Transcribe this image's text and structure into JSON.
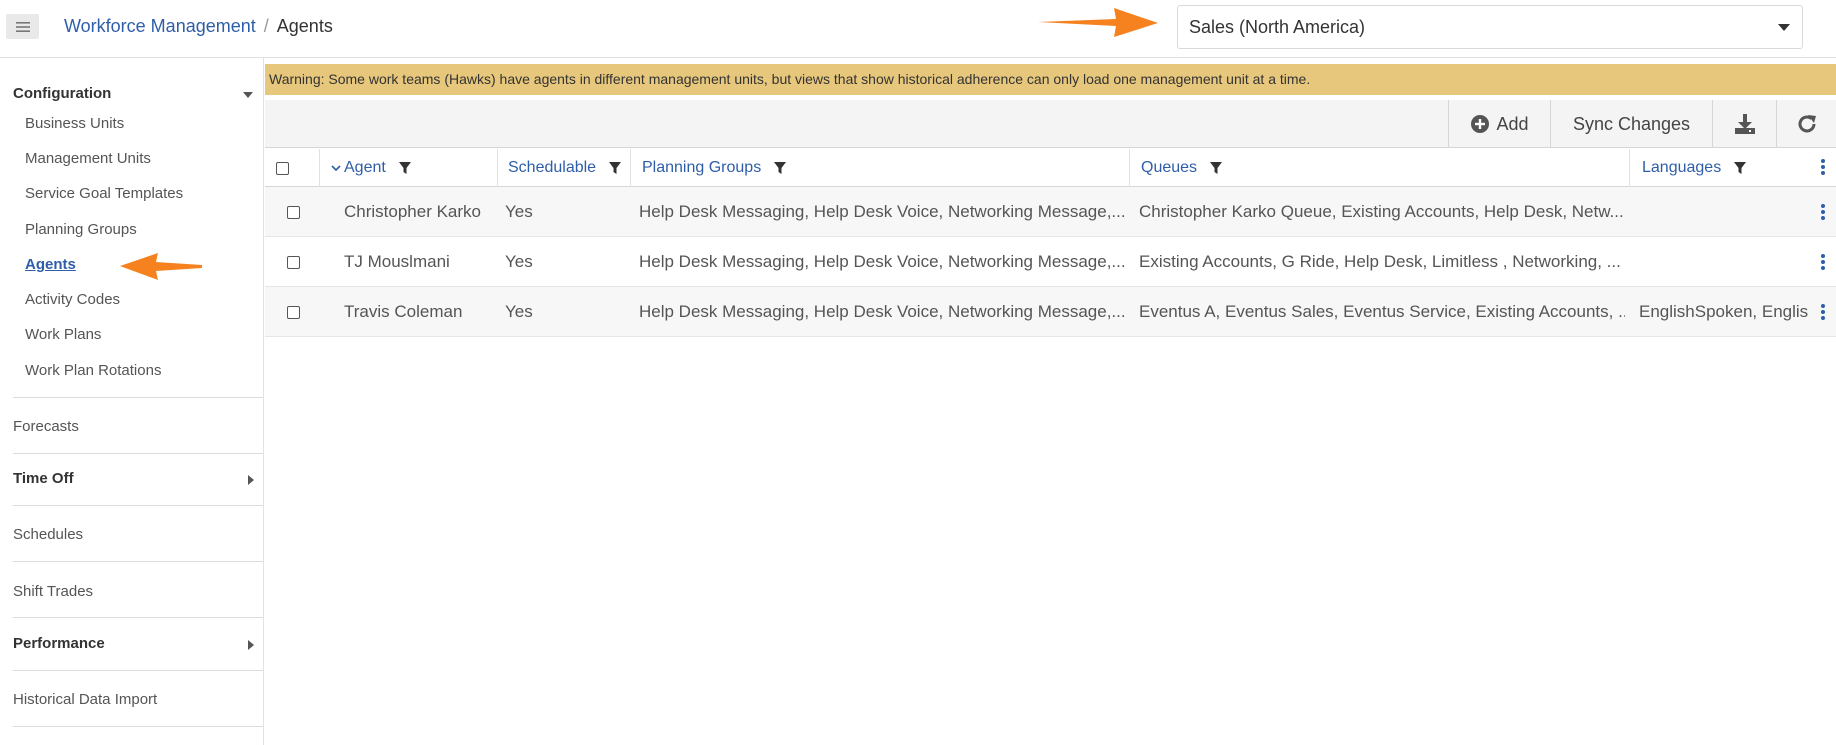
{
  "header": {
    "breadcrumb": {
      "parent": "Workforce Management",
      "separator": "/",
      "current": "Agents"
    },
    "management_unit": {
      "selected": "Sales (North America)"
    }
  },
  "sidebar": {
    "configuration": {
      "label": "Configuration",
      "items": [
        {
          "label": "Business Units"
        },
        {
          "label": "Management Units"
        },
        {
          "label": "Service Goal Templates"
        },
        {
          "label": "Planning Groups"
        },
        {
          "label": "Agents",
          "active": true
        },
        {
          "label": "Activity Codes"
        },
        {
          "label": "Work Plans"
        },
        {
          "label": "Work Plan Rotations"
        }
      ]
    },
    "forecasts": "Forecasts",
    "time_off": "Time Off",
    "schedules": "Schedules",
    "shift_trades": "Shift Trades",
    "performance": "Performance",
    "historical_data_import": "Historical Data Import"
  },
  "warning": "Warning: Some work teams (Hawks) have agents in different management units, but views that show historical adherence can only load one management unit at a time.",
  "toolbar": {
    "add_label": "Add",
    "sync_label": "Sync Changes"
  },
  "table": {
    "columns": [
      "Agent",
      "Schedulable",
      "Planning Groups",
      "Queues",
      "Languages"
    ],
    "rows": [
      {
        "agent": "Christopher Karko",
        "schedulable": "Yes",
        "planning_groups": "Help Desk Messaging, Help Desk Voice, Networking Message,...",
        "queues": "Christopher Karko Queue, Existing Accounts, Help Desk, Netw...",
        "languages": ""
      },
      {
        "agent": "TJ Mouslmani",
        "schedulable": "Yes",
        "planning_groups": "Help Desk Messaging, Help Desk Voice, Networking Message,...",
        "queues": "Existing Accounts, G Ride, Help Desk, Limitless , Networking, ...",
        "languages": ""
      },
      {
        "agent": "Travis Coleman",
        "schedulable": "Yes",
        "planning_groups": "Help Desk Messaging, Help Desk Voice, Networking Message,...",
        "queues": "Eventus A, Eventus Sales, Eventus Service, Existing Accounts, ...",
        "languages": "EnglishSpoken, Englisl"
      }
    ]
  },
  "colors": {
    "link": "#2f5ea8",
    "warning_bg": "#e7c77b",
    "annotation_arrow": "#f5821f"
  }
}
